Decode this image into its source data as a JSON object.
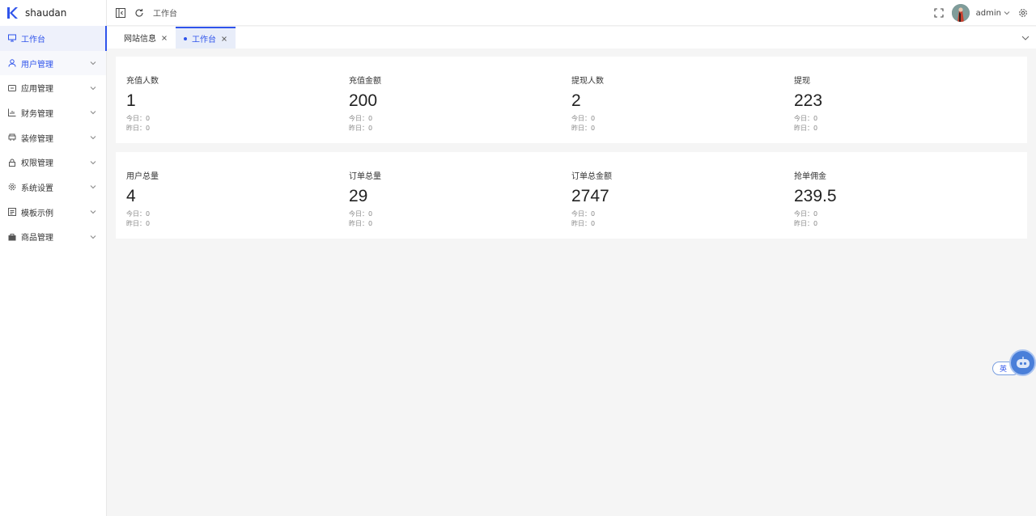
{
  "app": {
    "name": "shaudan",
    "accent_color": "#2f54eb"
  },
  "sidebar": {
    "items": [
      {
        "label": "工作台",
        "icon": "monitor-icon"
      },
      {
        "label": "用户管理",
        "icon": "user-icon"
      },
      {
        "label": "应用管理",
        "icon": "app-icon"
      },
      {
        "label": "财务管理",
        "icon": "chart-icon"
      },
      {
        "label": "装修管理",
        "icon": "decorate-icon"
      },
      {
        "label": "权限管理",
        "icon": "lock-icon"
      },
      {
        "label": "系统设置",
        "icon": "gear-icon"
      },
      {
        "label": "模板示例",
        "icon": "template-icon"
      },
      {
        "label": "商品管理",
        "icon": "bag-icon"
      }
    ]
  },
  "header": {
    "breadcrumb": "工作台",
    "username": "admin"
  },
  "tabs": [
    {
      "label": "网站信息",
      "active": false
    },
    {
      "label": "工作台",
      "active": true
    }
  ],
  "stats": {
    "row1": [
      {
        "label": "充值人数",
        "value": "1",
        "today": "今日：0",
        "yesterday": "昨日：0"
      },
      {
        "label": "充值金额",
        "value": "200",
        "today": "今日：0",
        "yesterday": "昨日：0"
      },
      {
        "label": "提现人数",
        "value": "2",
        "today": "今日：0",
        "yesterday": "昨日：0"
      },
      {
        "label": "提现",
        "value": "223",
        "today": "今日：0",
        "yesterday": "昨日：0"
      }
    ],
    "row2": [
      {
        "label": "用户总量",
        "value": "4",
        "today": "今日：0",
        "yesterday": "昨日：0"
      },
      {
        "label": "订单总量",
        "value": "29",
        "today": "今日：0",
        "yesterday": "昨日：0"
      },
      {
        "label": "订单总金额",
        "value": "2747",
        "today": "今日：0",
        "yesterday": "昨日：0"
      },
      {
        "label": "抢单佣金",
        "value": "239.5",
        "today": "今日：0",
        "yesterday": "昨日：0"
      }
    ]
  },
  "floating": {
    "lang_label": "英"
  }
}
